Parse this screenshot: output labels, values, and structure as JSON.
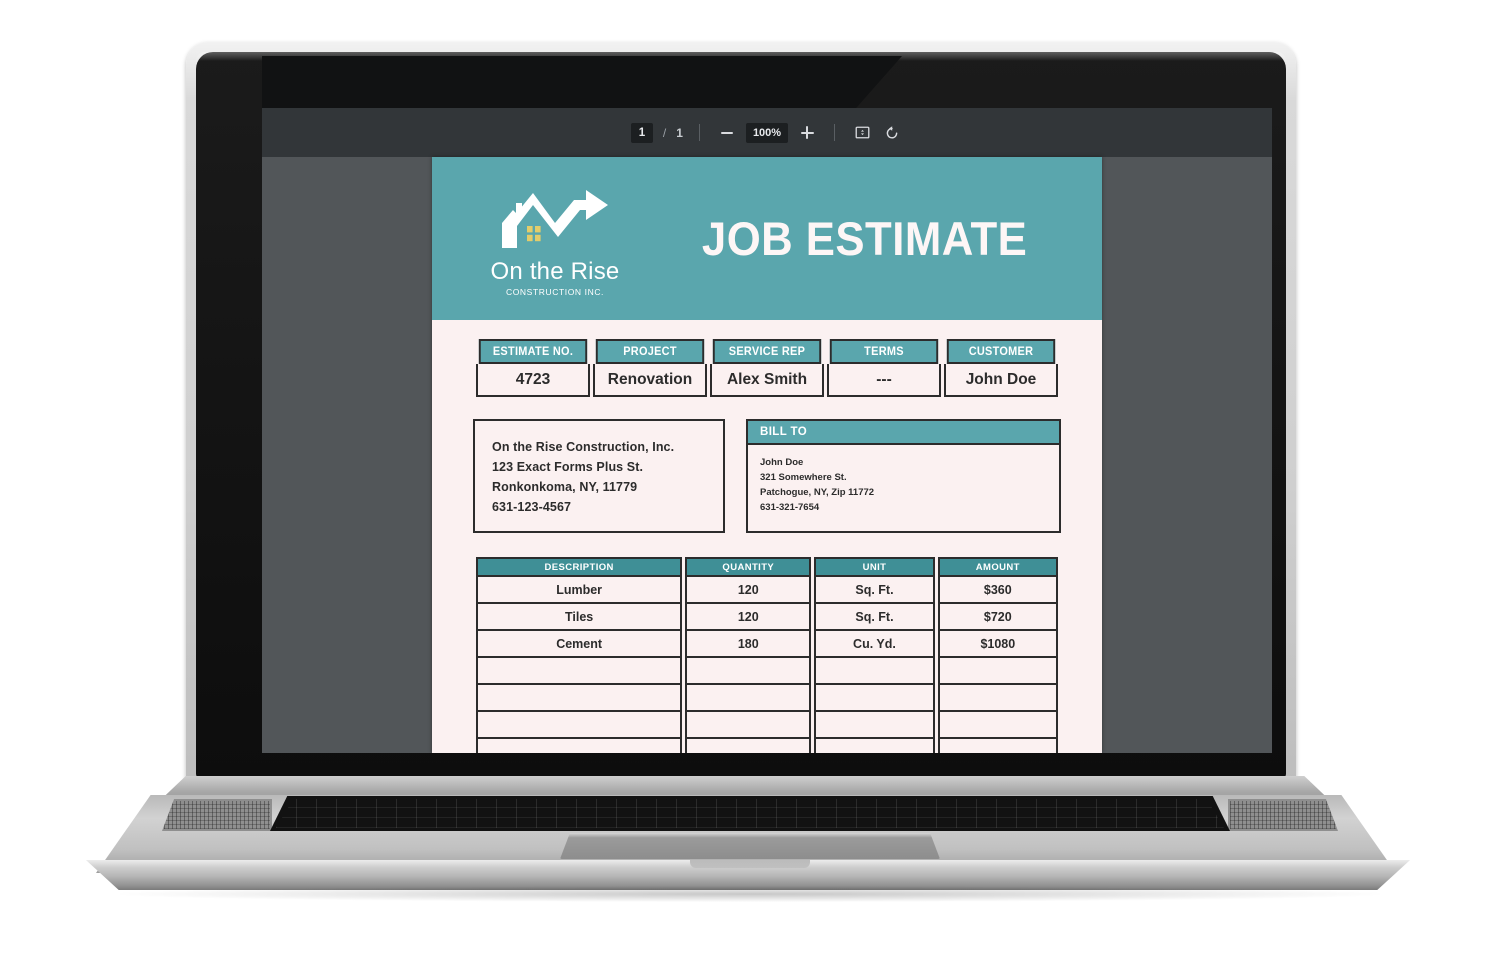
{
  "viewer": {
    "page_current": "1",
    "page_separator": "/",
    "page_total": "1",
    "zoom_level": "100%",
    "zoom_out_label": "−",
    "zoom_in_label": "+",
    "fit_icon": "fit-to-page-icon",
    "rotate_icon": "rotate-icon"
  },
  "colors": {
    "brand_teal": "#5aa6ad",
    "brand_teal_dark": "#3f8f96",
    "paper": "#fbf1f1",
    "ink": "#2c2c2c",
    "logo_window": "#e3cd6b",
    "toolbar_bg": "#323639",
    "viewer_bg": "#525659"
  },
  "document": {
    "title": "JOB ESTIMATE",
    "logo": {
      "icon": "house-rising-arrow-logo",
      "name": "On the Rise",
      "subtitle": "CONSTRUCTION INC."
    },
    "meta_table": {
      "headers": [
        "ESTIMATE NO.",
        "PROJECT",
        "SERVICE REP",
        "TERMS",
        "CUSTOMER"
      ],
      "values": [
        "4723",
        "Renovation",
        "Alex Smith",
        "---",
        "John Doe"
      ]
    },
    "from_address": [
      "On the Rise Construction, Inc.",
      "123 Exact Forms Plus St.",
      "Ronkonkoma, NY, 11779",
      "631-123-4567"
    ],
    "bill_to": {
      "heading": "BILL TO",
      "lines": [
        "John Doe",
        "321 Somewhere St.",
        "Patchogue, NY, Zip 11772",
        "631-321-7654"
      ]
    },
    "items_table": {
      "headers": [
        "DESCRIPTION",
        "QUANTITY",
        "UNIT",
        "AMOUNT"
      ],
      "rows": [
        [
          "Lumber",
          "120",
          "Sq. Ft.",
          "$360"
        ],
        [
          "Tiles",
          "120",
          "Sq. Ft.",
          "$720"
        ],
        [
          "Cement",
          "180",
          "Cu. Yd.",
          "$1080"
        ]
      ],
      "empty_row_count": 5
    }
  }
}
